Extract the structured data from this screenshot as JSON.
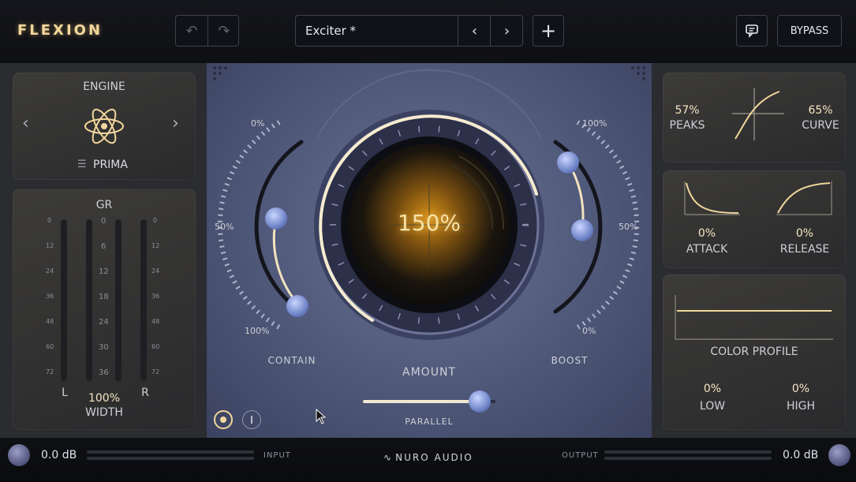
{
  "header": {
    "logo": "FLEXION",
    "undo_icon": "undo-icon",
    "redo_icon": "redo-icon",
    "preset_name": "Exciter *",
    "prev_icon": "chevron-left-icon",
    "next_icon": "chevron-right-icon",
    "add_icon": "plus-icon",
    "chat_icon": "chat-icon",
    "bypass_label": "BYPASS"
  },
  "engine": {
    "title": "ENGINE",
    "icon": "atom-icon",
    "menu_icon": "menu-icon",
    "name": "PRIMA"
  },
  "gr_meter": {
    "title": "GR",
    "left_scale": [
      "0",
      "12",
      "24",
      "36",
      "48",
      "60",
      "72"
    ],
    "center_scale": [
      "0",
      "6",
      "12",
      "18",
      "24",
      "30",
      "36"
    ],
    "right_scale": [
      "0",
      "12",
      "24",
      "36",
      "48",
      "60",
      "72"
    ],
    "left_channel": "L",
    "right_channel": "R",
    "width_value": "100%",
    "width_label": "WIDTH"
  },
  "center": {
    "amount_value": "150%",
    "amount_label": "AMOUNT",
    "contain_label": "CONTAIN",
    "contain_top": "0%",
    "contain_mid": "50%",
    "contain_bottom": "100%",
    "boost_label": "BOOST",
    "boost_top": "100%",
    "boost_mid": "50%",
    "boost_bottom": "0%",
    "parallel_label": "PARALLEL",
    "parallel_value": 0.88,
    "mode_icon_a": "circle-dot-icon",
    "mode_icon_b": "line-icon"
  },
  "right": {
    "peaks_value": "57%",
    "peaks_label": "PEAKS",
    "curve_value": "65%",
    "curve_label": "CURVE",
    "attack_value": "0%",
    "attack_label": "ATTACK",
    "release_value": "0%",
    "release_label": "RELEASE",
    "color_profile_label": "COLOR PROFILE",
    "low_value": "0%",
    "low_label": "LOW",
    "high_value": "0%",
    "high_label": "HIGH"
  },
  "footer": {
    "input_db": "0.0 dB",
    "input_label": "INPUT",
    "brand": "NURO AUDIO",
    "output_label": "OUTPUT",
    "output_db": "0.0 dB"
  },
  "colors": {
    "accent_gold": "#f2d79c",
    "panel_blue": "#5a6384"
  }
}
